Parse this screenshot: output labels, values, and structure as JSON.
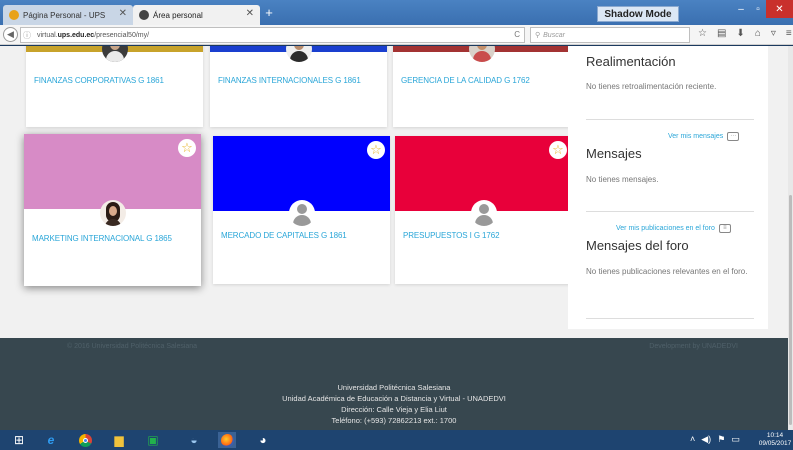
{
  "browser": {
    "tabs": [
      {
        "label": "Página Personal - UPS",
        "favicon_color": "#e8a21a"
      },
      {
        "label": "Área personal",
        "favicon_color": "#444444"
      }
    ],
    "shadow_mode_label": "Shadow Mode",
    "url_prefix": "virtual.",
    "url_domain": "ups.edu.ec",
    "url_path": "/presencial50/my/",
    "search_placeholder": "Buscar"
  },
  "courses_top": [
    {
      "title": "FINANZAS CORPORATIVAS G 1861",
      "color": "#c8a32b"
    },
    {
      "title": "FINANZAS INTERNACIONALES G 1861",
      "color": "#1a3fcf"
    },
    {
      "title": "GERENCIA DE LA CALIDAD G 1762",
      "color": "#a33333"
    }
  ],
  "courses_bottom": [
    {
      "title": "MARKETING INTERNACIONAL G 1865",
      "color": "#d78bc6",
      "starred": true
    },
    {
      "title": "MERCADO DE CAPITALES G 1861",
      "color": "#0000ff",
      "starred": true
    },
    {
      "title": "PRESUPUESTOS I G 1762",
      "color": "#e8003a",
      "starred": true
    }
  ],
  "sidebar": {
    "feedback_title": "Realimentación",
    "feedback_text": "No tienes retroalimentación reciente.",
    "messages_link": "Ver mis mensajes",
    "messages_title": "Mensajes",
    "messages_text": "No tienes mensajes.",
    "forum_link": "Ver mis publicaciones en el foro",
    "forum_title": "Mensajes del foro",
    "forum_text": "No tienes publicaciones relevantes en el foro."
  },
  "footer": {
    "copyright": "© 2016 Universidad Politécnica Salesiana",
    "developer": "Development by UNADEDVI",
    "lines": [
      "Universidad Politécnica Salesiana",
      "Unidad Académica de Educación a Distancia y Virtual - UNADEDVI",
      "Dirección: Calle Vieja y Elia Liut",
      "Teléfono: (+593) 72862213 ext.: 1700"
    ]
  },
  "taskbar": {
    "time": "10:14",
    "date": "09/05/2017"
  }
}
